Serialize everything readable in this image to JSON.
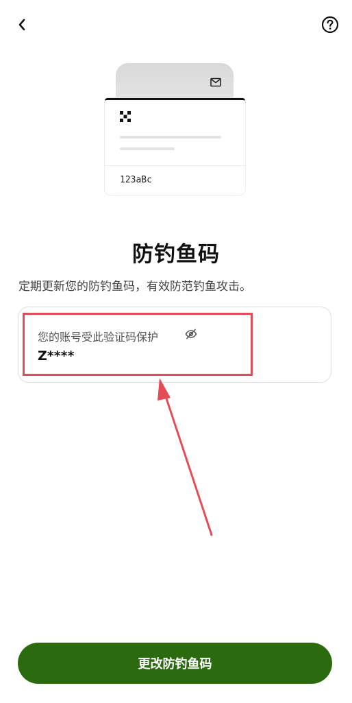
{
  "header": {
    "back_icon": "chevron-left-icon",
    "help_icon": "question-circle-icon"
  },
  "illustration": {
    "mail_icon": "mail-icon",
    "logo_icon": "okx-logo-icon",
    "code_sample": "123aBc"
  },
  "page": {
    "title": "防钓鱼码",
    "description": "定期更新您的防钓鱼码，有效防范钓鱼攻击。"
  },
  "code_card": {
    "label": "您的账号受此验证码保护",
    "toggle_icon": "eye-off-icon",
    "masked_value": "Z****"
  },
  "annotation": {
    "highlight_color": "#e44c56"
  },
  "actions": {
    "change_label": "更改防钓鱼码",
    "button_color": "#2b6a0e"
  }
}
